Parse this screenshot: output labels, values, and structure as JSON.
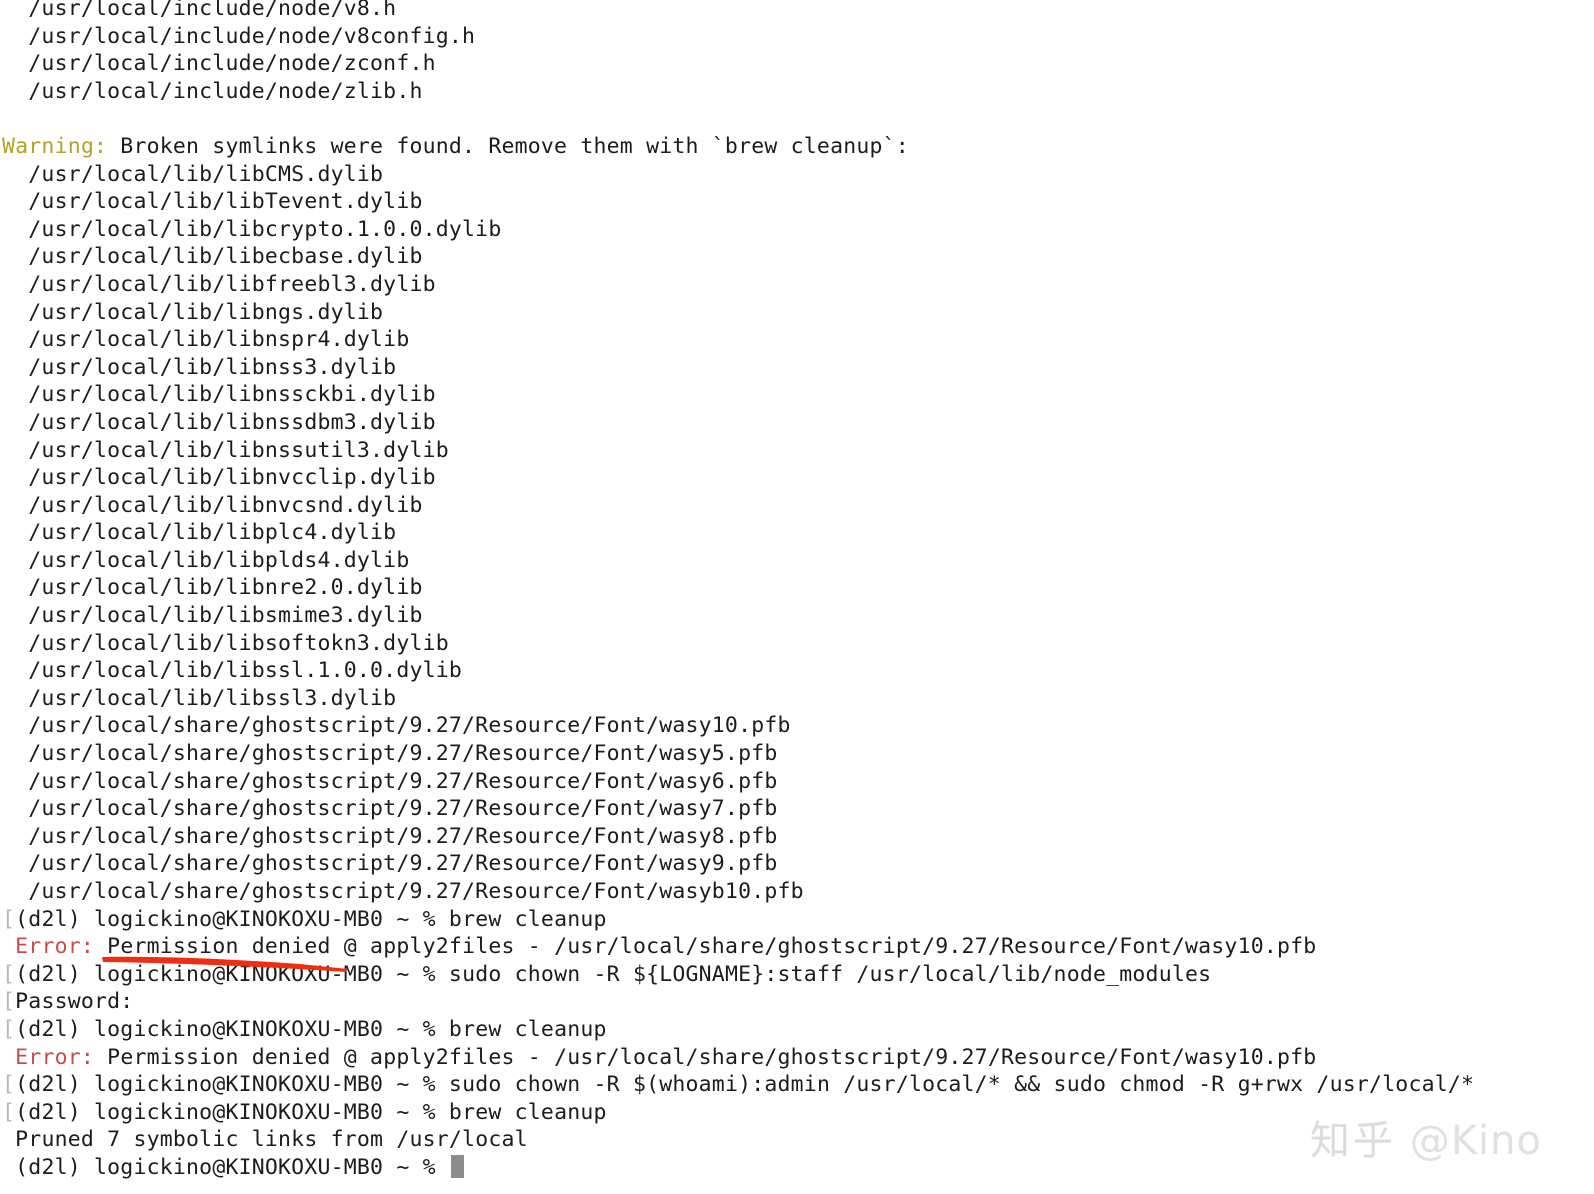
{
  "terminal": {
    "shell_prompt": "[(d2l) logickino@KINOKOXU-MB0 ~ % ",
    "prompt_user": "logickino",
    "prompt_host": "KINOKOXU-MB0",
    "prompt_env": "(d2l)",
    "prompt_cwd": "~",
    "prompt_symbol": "%",
    "colors": {
      "background": "#ffffff",
      "foreground": "#1c1c1c",
      "warning": "#b0a22a",
      "error": "#c2504a",
      "prompt_mark": "#b9b9b9",
      "cursor": "#8c8c8c",
      "annotation": "#ee2d13"
    },
    "lines": [
      {
        "type": "plain",
        "text": "  /usr/local/include/node/v8.h"
      },
      {
        "type": "plain",
        "text": "  /usr/local/include/node/v8config.h"
      },
      {
        "type": "plain",
        "text": "  /usr/local/include/node/zconf.h"
      },
      {
        "type": "plain",
        "text": "  /usr/local/include/node/zlib.h"
      },
      {
        "type": "blank",
        "text": ""
      },
      {
        "type": "warning",
        "label": "Warning:",
        "text": " Broken symlinks were found. Remove them with `brew cleanup`:"
      },
      {
        "type": "plain",
        "text": "  /usr/local/lib/libCMS.dylib"
      },
      {
        "type": "plain",
        "text": "  /usr/local/lib/libTevent.dylib"
      },
      {
        "type": "plain",
        "text": "  /usr/local/lib/libcrypto.1.0.0.dylib"
      },
      {
        "type": "plain",
        "text": "  /usr/local/lib/libecbase.dylib"
      },
      {
        "type": "plain",
        "text": "  /usr/local/lib/libfreebl3.dylib"
      },
      {
        "type": "plain",
        "text": "  /usr/local/lib/libngs.dylib"
      },
      {
        "type": "plain",
        "text": "  /usr/local/lib/libnspr4.dylib"
      },
      {
        "type": "plain",
        "text": "  /usr/local/lib/libnss3.dylib"
      },
      {
        "type": "plain",
        "text": "  /usr/local/lib/libnssckbi.dylib"
      },
      {
        "type": "plain",
        "text": "  /usr/local/lib/libnssdbm3.dylib"
      },
      {
        "type": "plain",
        "text": "  /usr/local/lib/libnssutil3.dylib"
      },
      {
        "type": "plain",
        "text": "  /usr/local/lib/libnvcclip.dylib"
      },
      {
        "type": "plain",
        "text": "  /usr/local/lib/libnvcsnd.dylib"
      },
      {
        "type": "plain",
        "text": "  /usr/local/lib/libplc4.dylib"
      },
      {
        "type": "plain",
        "text": "  /usr/local/lib/libplds4.dylib"
      },
      {
        "type": "plain",
        "text": "  /usr/local/lib/libnre2.0.dylib"
      },
      {
        "type": "plain",
        "text": "  /usr/local/lib/libsmime3.dylib"
      },
      {
        "type": "plain",
        "text": "  /usr/local/lib/libsoftokn3.dylib"
      },
      {
        "type": "plain",
        "text": "  /usr/local/lib/libssl.1.0.0.dylib"
      },
      {
        "type": "plain",
        "text": "  /usr/local/lib/libssl3.dylib"
      },
      {
        "type": "plain",
        "text": "  /usr/local/share/ghostscript/9.27/Resource/Font/wasy10.pfb"
      },
      {
        "type": "plain",
        "text": "  /usr/local/share/ghostscript/9.27/Resource/Font/wasy5.pfb"
      },
      {
        "type": "plain",
        "text": "  /usr/local/share/ghostscript/9.27/Resource/Font/wasy6.pfb"
      },
      {
        "type": "plain",
        "text": "  /usr/local/share/ghostscript/9.27/Resource/Font/wasy7.pfb"
      },
      {
        "type": "plain",
        "text": "  /usr/local/share/ghostscript/9.27/Resource/Font/wasy8.pfb"
      },
      {
        "type": "plain",
        "text": "  /usr/local/share/ghostscript/9.27/Resource/Font/wasy9.pfb"
      },
      {
        "type": "plain",
        "text": "  /usr/local/share/ghostscript/9.27/Resource/Font/wasyb10.pfb"
      },
      {
        "type": "prompt",
        "mark": "[",
        "prompt": "(d2l) logickino@KINOKOXU-MB0 ~ % ",
        "command": "brew cleanup"
      },
      {
        "type": "error",
        "mark": " ",
        "label": "Error:",
        "text": " Permission denied @ apply2files - /usr/local/share/ghostscript/9.27/Resource/Font/wasy10.pfb"
      },
      {
        "type": "prompt",
        "mark": "[",
        "prompt": "(d2l) logickino@KINOKOXU-MB0 ~ % ",
        "command": "sudo chown -R ${LOGNAME}:staff /usr/local/lib/node_modules"
      },
      {
        "type": "plain",
        "mark": "[",
        "text": "Password:"
      },
      {
        "type": "prompt",
        "mark": "[",
        "prompt": "(d2l) logickino@KINOKOXU-MB0 ~ % ",
        "command": "brew cleanup"
      },
      {
        "type": "error",
        "mark": " ",
        "label": "Error:",
        "text": " Permission denied @ apply2files - /usr/local/share/ghostscript/9.27/Resource/Font/wasy10.pfb"
      },
      {
        "type": "prompt",
        "mark": "[",
        "prompt": "(d2l) logickino@KINOKOXU-MB0 ~ % ",
        "command": "sudo chown -R $(whoami):admin /usr/local/* && sudo chmod -R g+rwx /usr/local/*"
      },
      {
        "type": "prompt",
        "mark": "[",
        "prompt": "(d2l) logickino@KINOKOXU-MB0 ~ % ",
        "command": "brew cleanup"
      },
      {
        "type": "plain",
        "mark": " ",
        "text": "Pruned 7 symbolic links from /usr/local"
      },
      {
        "type": "prompt_cursor",
        "mark": " ",
        "prompt": "(d2l) logickino@KINOKOXU-MB0 ~ % ",
        "command": ""
      }
    ]
  },
  "annotation": {
    "type": "underline",
    "target_text": "Permission denied",
    "color": "#ee2d13"
  },
  "watermark": {
    "site": "知乎",
    "handle": "@Kino"
  }
}
